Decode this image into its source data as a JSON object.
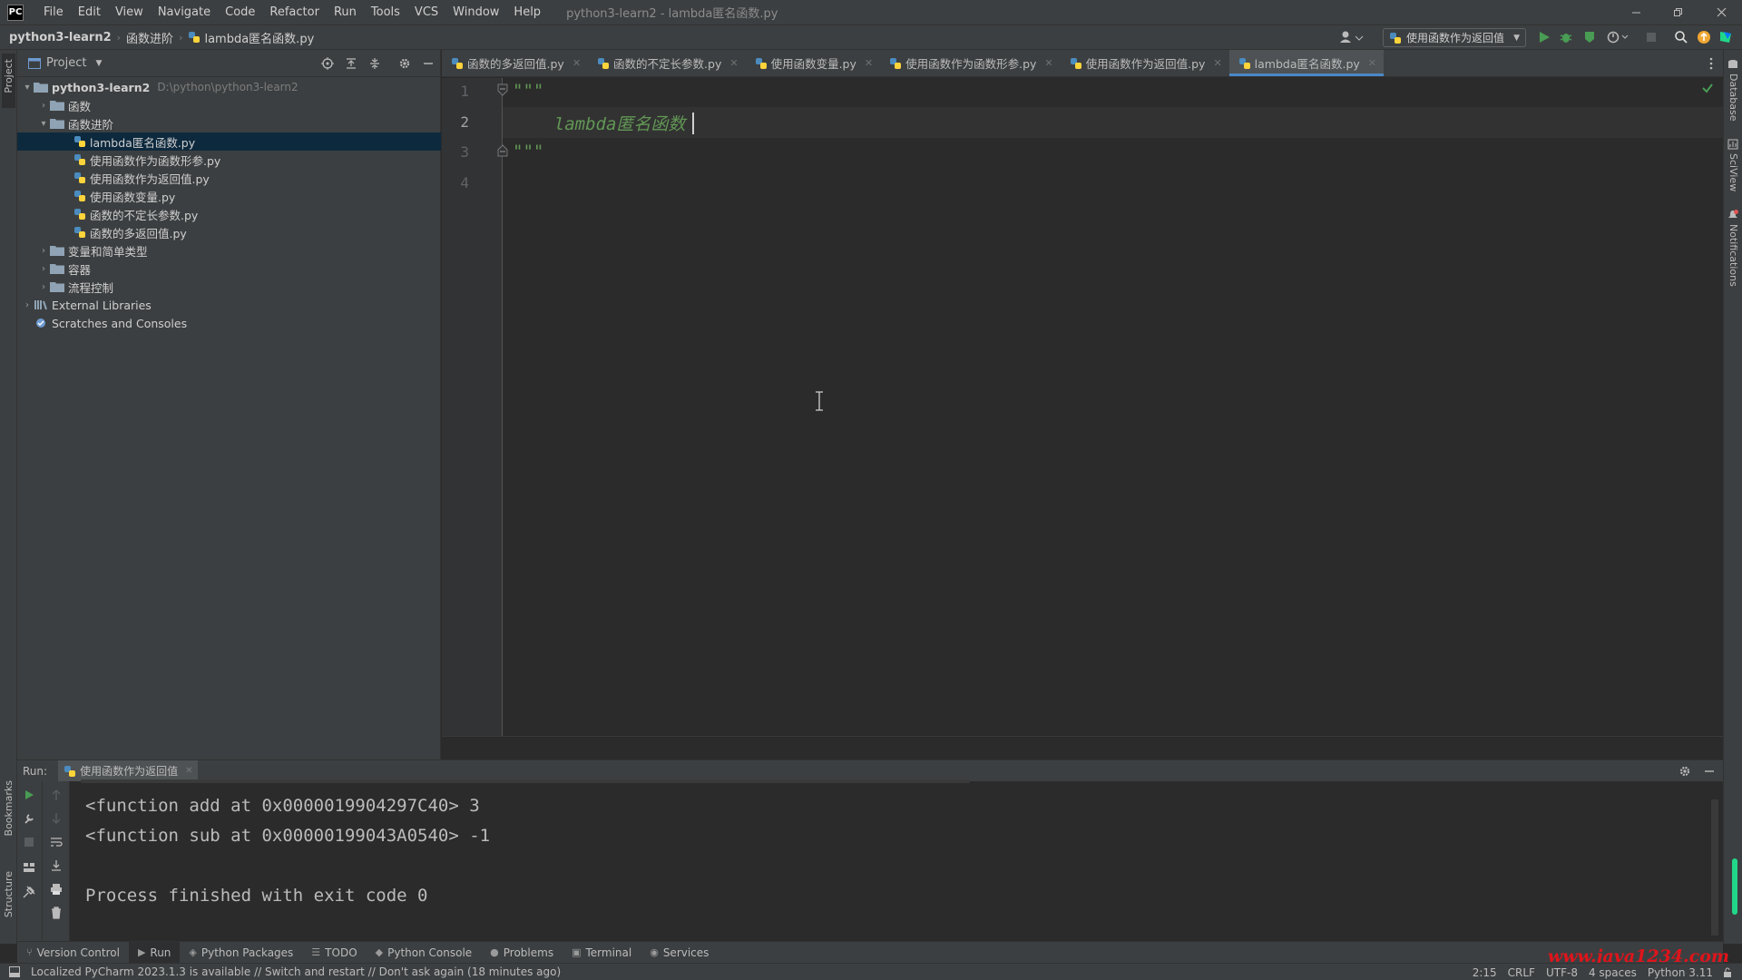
{
  "app": {
    "logo": "PC",
    "window_title": "python3-learn2 - lambda匿名函数.py"
  },
  "menu": [
    "File",
    "Edit",
    "View",
    "Navigate",
    "Code",
    "Refactor",
    "Run",
    "Tools",
    "VCS",
    "Window",
    "Help"
  ],
  "breadcrumb": [
    "python3-learn2",
    "函数进阶",
    "lambda匿名函数.py"
  ],
  "run_config": {
    "label": "使用函数作为返回值"
  },
  "project": {
    "header": "Project",
    "root": {
      "name": "python3-learn2",
      "path": "D:\\python\\python3-learn2"
    },
    "tree": [
      {
        "label": "函数",
        "type": "folder",
        "expanded": false
      },
      {
        "label": "函数进阶",
        "type": "folder",
        "expanded": true
      },
      {
        "label": "lambda匿名函数.py",
        "type": "py",
        "selected": true
      },
      {
        "label": "使用函数作为函数形参.py",
        "type": "py"
      },
      {
        "label": "使用函数作为返回值.py",
        "type": "py"
      },
      {
        "label": "使用函数变量.py",
        "type": "py"
      },
      {
        "label": "函数的不定长参数.py",
        "type": "py"
      },
      {
        "label": "函数的多返回值.py",
        "type": "py"
      },
      {
        "label": "变量和简单类型",
        "type": "folder",
        "expanded": false
      },
      {
        "label": "容器",
        "type": "folder",
        "expanded": false
      },
      {
        "label": "流程控制",
        "type": "folder",
        "expanded": false
      }
    ],
    "external_libraries": "External Libraries",
    "scratches": "Scratches and Consoles"
  },
  "tabs": [
    {
      "label": "函数的多返回值.py",
      "active": false
    },
    {
      "label": "函数的不定长参数.py",
      "active": false
    },
    {
      "label": "使用函数变量.py",
      "active": false
    },
    {
      "label": "使用函数作为函数形参.py",
      "active": false
    },
    {
      "label": "使用函数作为返回值.py",
      "active": false
    },
    {
      "label": "lambda匿名函数.py",
      "active": true
    }
  ],
  "editor": {
    "lines": [
      "\"\"\"",
      "    lambda匿名函数",
      "\"\"\"",
      ""
    ],
    "line_numbers": [
      "1",
      "2",
      "3",
      "4"
    ]
  },
  "run": {
    "label": "Run:",
    "tab": "使用函数作为返回值",
    "output": [
      "<function add at 0x0000019904297C40> 3",
      "<function sub at 0x00000199043A0540> -1",
      "",
      "Process finished with exit code 0"
    ]
  },
  "side_labels": {
    "left": [
      "Project",
      "Bookmarks",
      "Structure"
    ],
    "right": [
      "Database",
      "SciView",
      "Notifications"
    ]
  },
  "bottom_tabs": [
    {
      "label": "Version Control",
      "icon": "branch-icon"
    },
    {
      "label": "Run",
      "icon": "play-icon",
      "active": true
    },
    {
      "label": "Python Packages",
      "icon": "packages-icon"
    },
    {
      "label": "TODO",
      "icon": "list-icon"
    },
    {
      "label": "Python Console",
      "icon": "python-icon"
    },
    {
      "label": "Problems",
      "icon": "info-icon"
    },
    {
      "label": "Terminal",
      "icon": "terminal-icon"
    },
    {
      "label": "Services",
      "icon": "services-icon"
    }
  ],
  "status": {
    "message": "Localized PyCharm 2023.1.3 is available // Switch and restart // Don't ask again (18 minutes ago)",
    "position": "2:15",
    "line_sep": "CRLF",
    "encoding": "UTF-8",
    "indent": "4 spaces",
    "interpreter": "Python 3.11",
    "watermark": "www.java1234.com"
  },
  "colors": {
    "accent": "#4a88c7",
    "string": "#629755",
    "selection": "#0d293e",
    "run_green": "#499c54",
    "watermark": "#e0141b"
  }
}
